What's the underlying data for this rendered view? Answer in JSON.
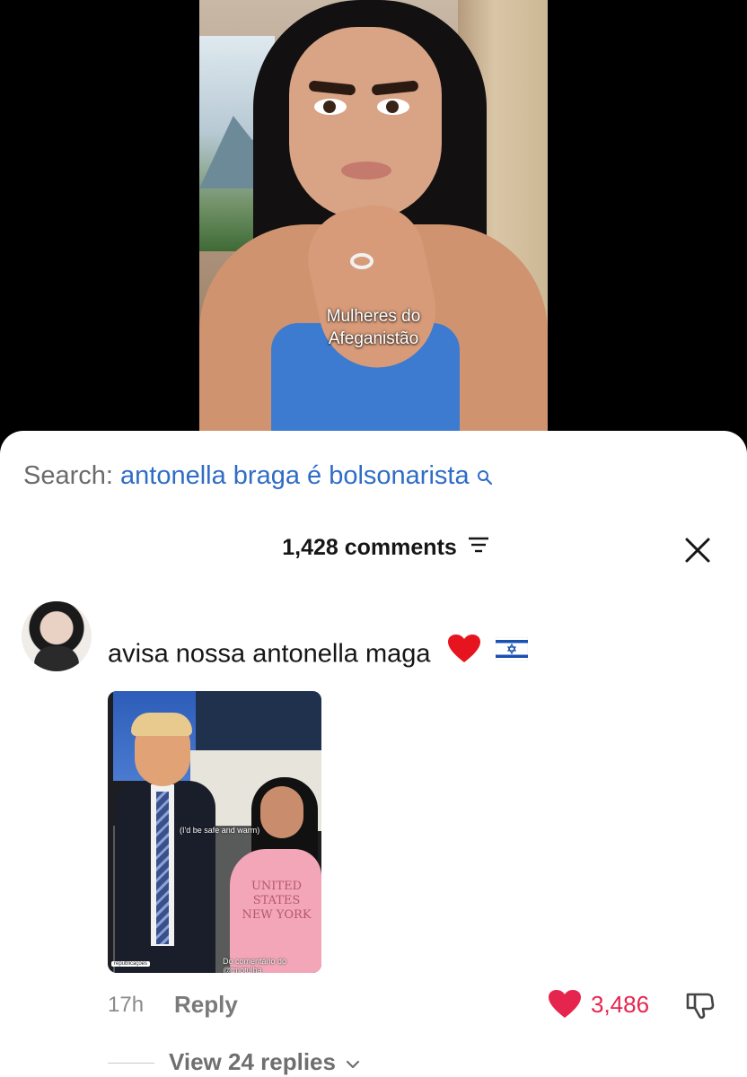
{
  "video": {
    "caption_line1": "Mulheres do",
    "caption_line2": "Afeganistão"
  },
  "search": {
    "prefix": "Search:",
    "term": "antonella braga é bolsonarista",
    "icon": "search-icon"
  },
  "header": {
    "comment_count": "1,428 comments",
    "filter_icon": "filter-icon",
    "close_icon": "close-icon"
  },
  "comment": {
    "text": "avisa nossa antonella maga",
    "emojis": [
      "red-heart",
      "israel-flag"
    ],
    "attachment": {
      "caption": "(I'd be safe and warm)",
      "sweater_line1": "UNITED STATES",
      "sweater_line2": "NEW YORK",
      "badge": "republicações",
      "watermark": "Do comentário do @tmotulha"
    },
    "time": "17h",
    "reply_label": "Reply",
    "like_count": "3,486",
    "view_replies": "View 24 replies"
  },
  "colors": {
    "search_term": "#2f6cc6",
    "like": "#e6254e",
    "sheet_bg": "#ffffff",
    "background": "#000000"
  }
}
